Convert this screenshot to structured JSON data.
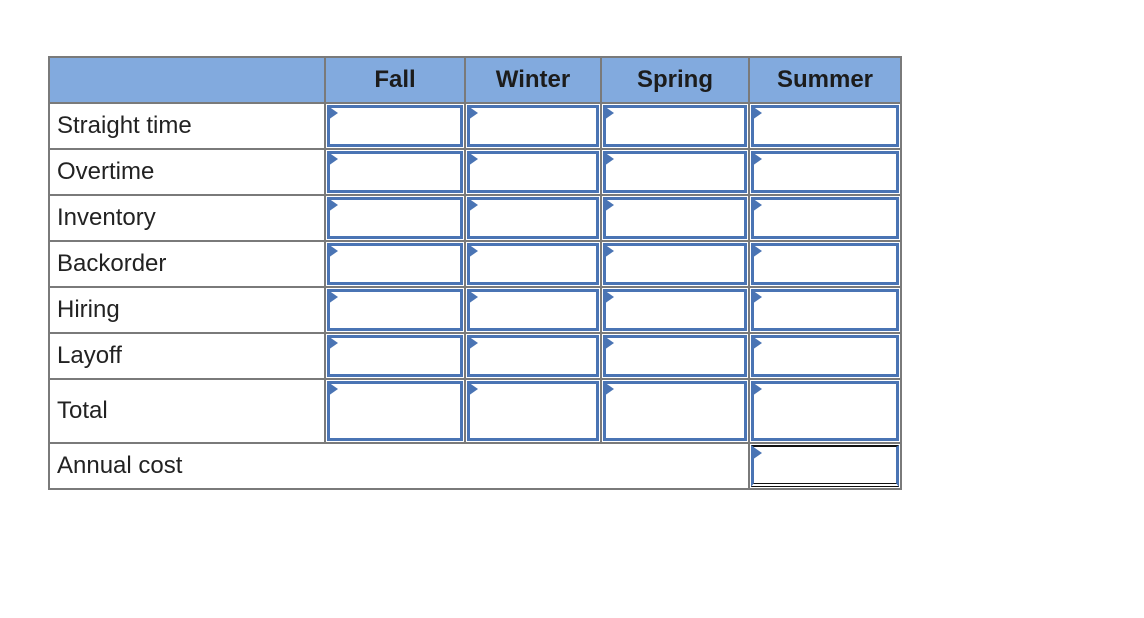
{
  "table": {
    "header_corner": "",
    "columns": [
      "Fall",
      "Winter",
      "Spring",
      "Summer"
    ],
    "rows": [
      {
        "label": "Straight time",
        "values": [
          "",
          "",
          "",
          ""
        ]
      },
      {
        "label": "Overtime",
        "values": [
          "",
          "",
          "",
          ""
        ]
      },
      {
        "label": "Inventory",
        "values": [
          "",
          "",
          "",
          ""
        ]
      },
      {
        "label": "Backorder",
        "values": [
          "",
          "",
          "",
          ""
        ]
      },
      {
        "label": "Hiring",
        "values": [
          "",
          "",
          "",
          ""
        ]
      },
      {
        "label": "Layoff",
        "values": [
          "",
          "",
          "",
          ""
        ]
      },
      {
        "label": "Total",
        "values": [
          "",
          "",
          "",
          ""
        ]
      }
    ],
    "annual_cost": {
      "label": "Annual cost",
      "value": ""
    }
  },
  "colors": {
    "header_bg": "#82aade",
    "input_border": "#4a74b4",
    "grid_border": "#7a7a7a"
  }
}
